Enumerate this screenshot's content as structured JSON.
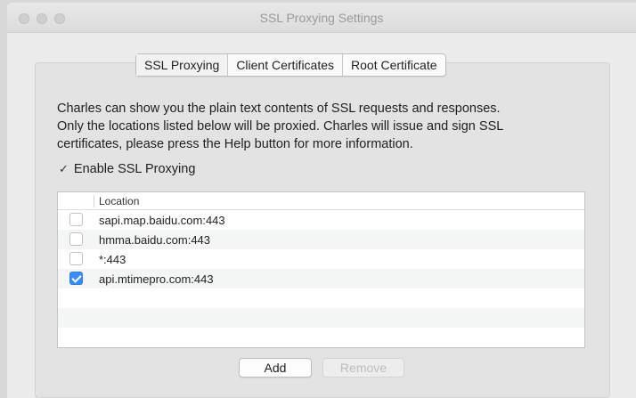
{
  "window": {
    "title": "SSL Proxying Settings"
  },
  "tabs": [
    {
      "label": "SSL Proxying",
      "active": true
    },
    {
      "label": "Client Certificates",
      "active": false
    },
    {
      "label": "Root Certificate",
      "active": false
    }
  ],
  "description": {
    "line1": "Charles can show you the plain text contents of SSL requests and responses.",
    "line2": "Only the locations listed below will be proxied. Charles will issue and sign SSL",
    "line3": "certificates, please press the Help button for more information."
  },
  "enable_ssl": {
    "label": "Enable SSL Proxying",
    "checked": true
  },
  "table": {
    "column_header": "Location",
    "rows": [
      {
        "location": "sapi.map.baidu.com:443",
        "checked": false
      },
      {
        "location": "hmma.baidu.com:443",
        "checked": false
      },
      {
        "location": "*:443",
        "checked": false
      },
      {
        "location": "api.mtimepro.com:443",
        "checked": true
      }
    ]
  },
  "buttons": {
    "add_label": "Add",
    "remove_label": "Remove"
  },
  "colors": {
    "checkbox_accent": "#3b8cf5"
  }
}
